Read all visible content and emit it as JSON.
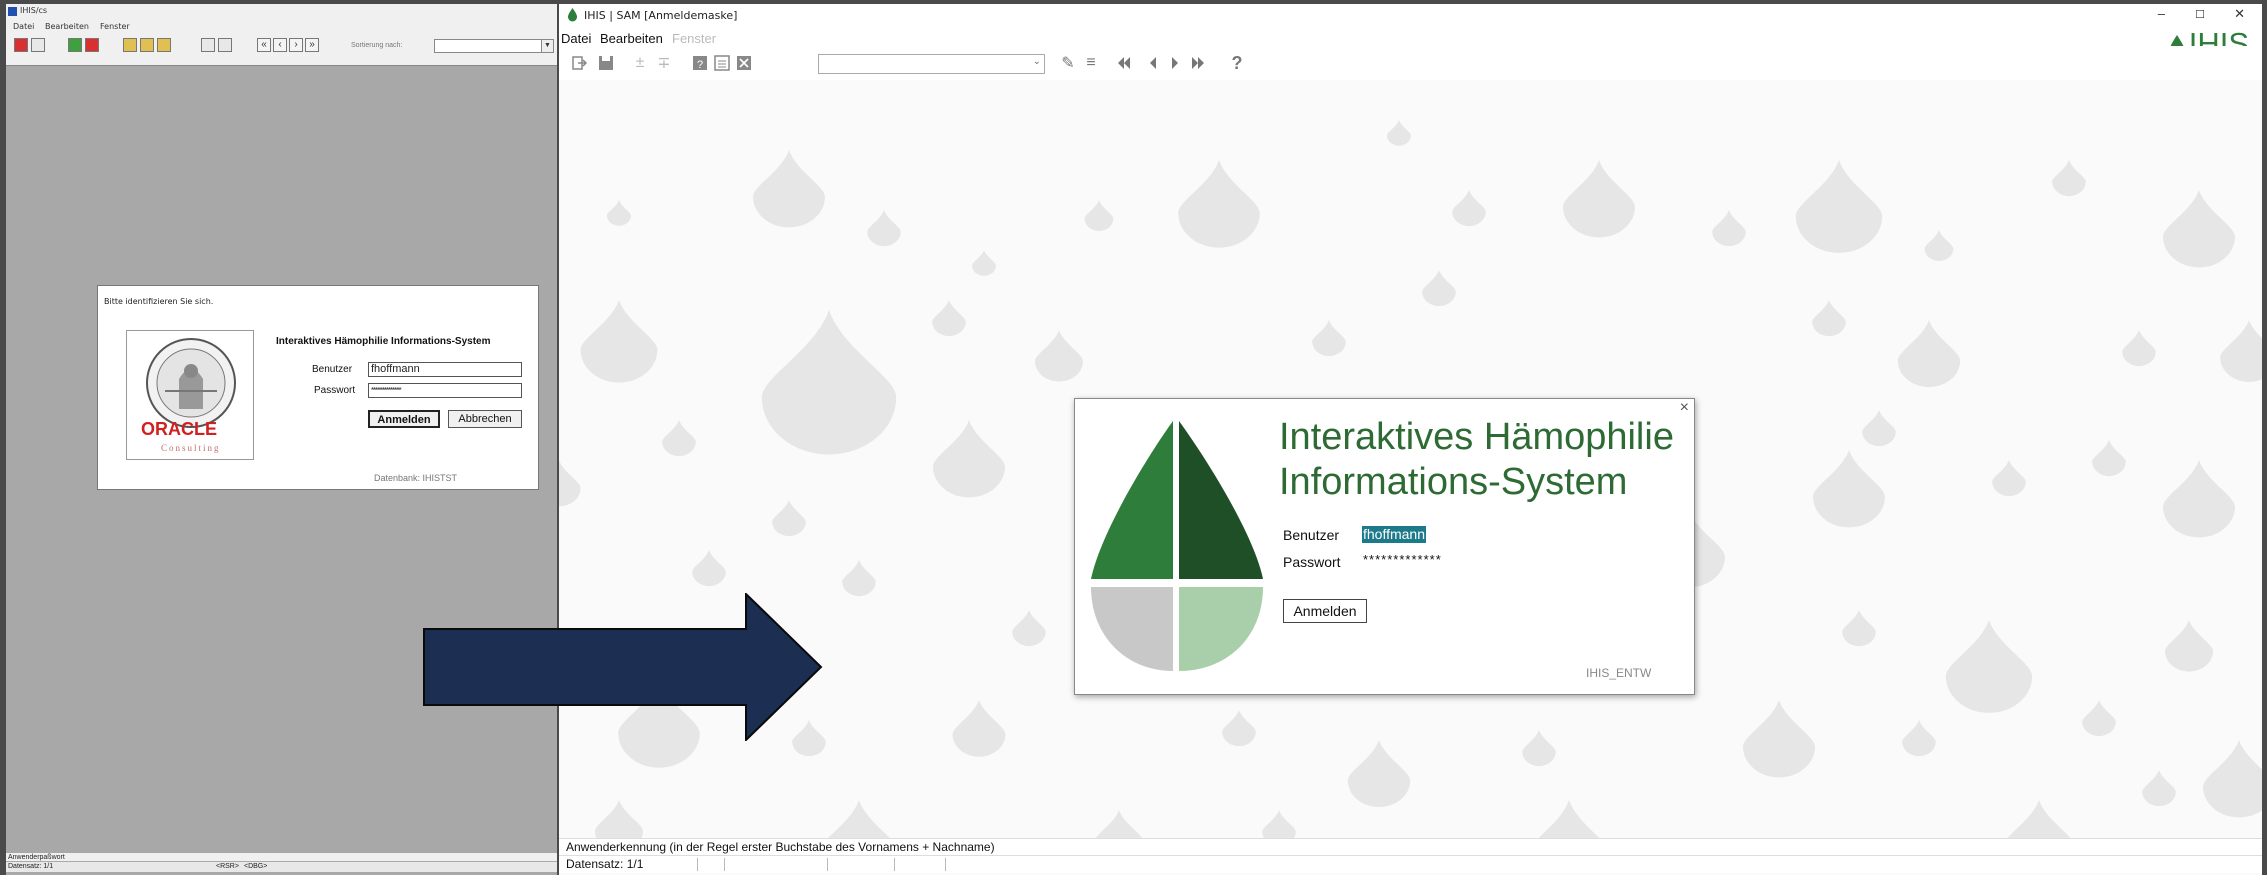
{
  "old_window": {
    "title": "IHIS/cs",
    "menu": [
      "Datei",
      "Bearbeiten",
      "Fenster"
    ],
    "sort_label": "Sortierung nach:",
    "login": {
      "prompt": "Bitte identifizieren Sie sich.",
      "system_title": "Interaktives Hämophilie Informations-System",
      "user_label": "Benutzer",
      "user_value": "fhoffmann",
      "password_label": "Passwort",
      "password_value": "**************",
      "login_button": "Anmelden",
      "cancel_button": "Abbrechen",
      "database": "Datenbank: IHISTST",
      "logo_text": "ORACLE",
      "logo_sub": "Consulting"
    },
    "status_line": "Anwenderpaßwort",
    "record_line": "Datensatz: 1/1",
    "status_tags": [
      "<RSR>",
      "<DBG>"
    ]
  },
  "new_window": {
    "title": "IHIS | SAM [Anmeldemaske]",
    "window_controls": [
      "–",
      "☐",
      "✕"
    ],
    "menu": [
      {
        "label": "Datei",
        "enabled": true
      },
      {
        "label": "Bearbeiten",
        "enabled": true
      },
      {
        "label": "Fenster",
        "enabled": false
      }
    ],
    "logo": "IHIS",
    "toolbar_icons": [
      "exit-icon",
      "save-icon",
      "insert-record-icon",
      "delete-record-icon",
      "query-icon",
      "list-icon",
      "close-form-icon",
      "edit-pencil-icon",
      "menu-lines-icon",
      "first-record-icon",
      "prev-record-icon",
      "next-record-icon",
      "last-record-icon",
      "help-icon"
    ],
    "dialog": {
      "title_line1": "Interaktives Hämophilie",
      "title_line2": "Informations-System",
      "user_label": "Benutzer",
      "user_value": "fhoffmann",
      "password_label": "Passwort",
      "password_value": "*************",
      "login_button": "Anmelden",
      "database": "IHIS_ENTW",
      "close": "×"
    },
    "status_hint": "Anwenderkennung (in der Regel erster Buchstabe des Vornamens + Nachname)",
    "record_line": "Datensatz: 1/1"
  },
  "colors": {
    "brand_green": "#2e7d3a",
    "dark_green": "#1f4f26",
    "light_green": "#a8cfaa",
    "arrow_fill": "#1c2e52"
  }
}
